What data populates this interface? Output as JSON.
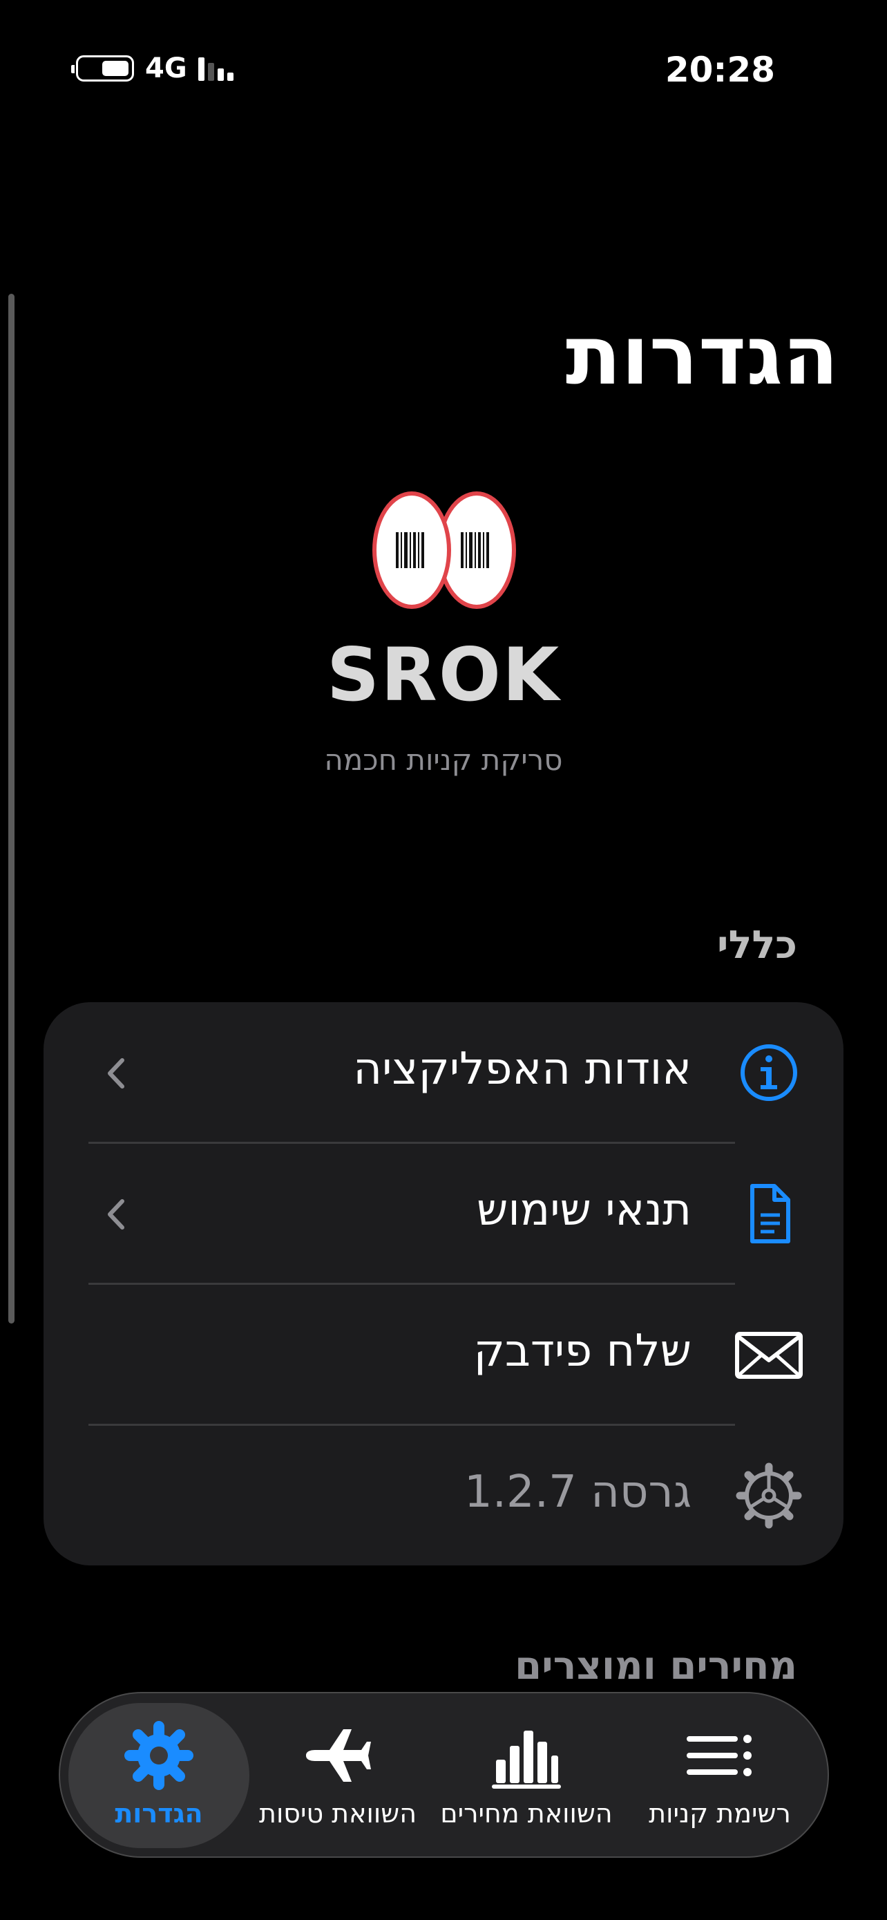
{
  "status_bar": {
    "time": "20:28",
    "network": "4G"
  },
  "page_title": "הגדרות",
  "app": {
    "name": "SROK",
    "tagline": "סריקת קניות חכמה"
  },
  "sections": {
    "general": {
      "header": "כללי",
      "rows": [
        {
          "label": "אודות האפליקציה",
          "icon": "info-icon"
        },
        {
          "label": "תנאי שימוש",
          "icon": "document-icon"
        },
        {
          "label": "שלח פידבק",
          "icon": "envelope-icon"
        },
        {
          "label": "גרסה 1.2.7",
          "icon": "gear-icon"
        }
      ]
    },
    "prices": {
      "header": "מחירים ומוצרים"
    }
  },
  "tabbar": {
    "tabs": [
      {
        "label": "רשימת קניות",
        "icon": "list-icon"
      },
      {
        "label": "השוואת מחירים",
        "icon": "bar-chart-icon"
      },
      {
        "label": "השוואת טיסות",
        "icon": "airplane-icon"
      },
      {
        "label": "הגדרות",
        "icon": "gear-icon"
      }
    ],
    "active": "הגדרות"
  },
  "colors": {
    "accent": "#1a8cff",
    "background": "#000000",
    "card": "#1c1c1e",
    "logo_red": "#e0444a"
  }
}
